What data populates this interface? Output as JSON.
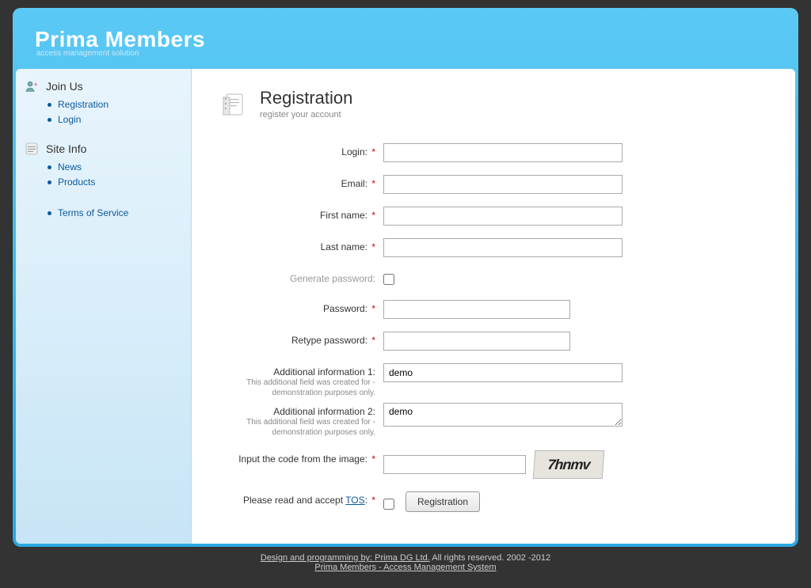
{
  "header": {
    "title": "Prima Members",
    "tagline": "access management solution"
  },
  "sidebar": {
    "groups": [
      {
        "title": "Join Us",
        "icon": "user-add-icon",
        "items": [
          {
            "label": "Registration"
          },
          {
            "label": "Login"
          }
        ]
      },
      {
        "title": "Site Info",
        "icon": "info-icon",
        "items": [
          {
            "label": "News"
          },
          {
            "label": "Products"
          }
        ]
      }
    ],
    "extra": [
      {
        "label": "Terms of Service"
      }
    ]
  },
  "page": {
    "title": "Registration",
    "subtitle": "register your account"
  },
  "form": {
    "login": {
      "label": "Login:",
      "value": "",
      "required": true
    },
    "email": {
      "label": "Email:",
      "value": "",
      "required": true
    },
    "first_name": {
      "label": "First name:",
      "value": "",
      "required": true
    },
    "last_name": {
      "label": "Last name:",
      "value": "",
      "required": true
    },
    "gen_pw": {
      "label": "Generate password:",
      "checked": false
    },
    "password": {
      "label": "Password:",
      "value": "",
      "required": true
    },
    "retype": {
      "label": "Retype password:",
      "value": "",
      "required": true
    },
    "add1": {
      "label": "Additional information 1:",
      "hint": "This additional field was created for - demonstration purposes only.",
      "value": "demo"
    },
    "add2": {
      "label": "Additional information 2:",
      "hint": "This additional field was created for - demonstration purposes only.",
      "value": "demo"
    },
    "captcha": {
      "label": "Input the code from the image:",
      "value": "",
      "required": true,
      "code": "7hnmv"
    },
    "tos": {
      "prefix": "Please read and accept ",
      "link_text": "TOS",
      "suffix": ":",
      "required": true,
      "checked": false
    },
    "submit_label": "Registration",
    "required_mark": "*"
  },
  "footer": {
    "line1_link": "Design and programming by: Prima DG Ltd.",
    "line1_rest": " All rights reserved. 2002 -2012",
    "line2": "Prima Members - Access Management System"
  }
}
